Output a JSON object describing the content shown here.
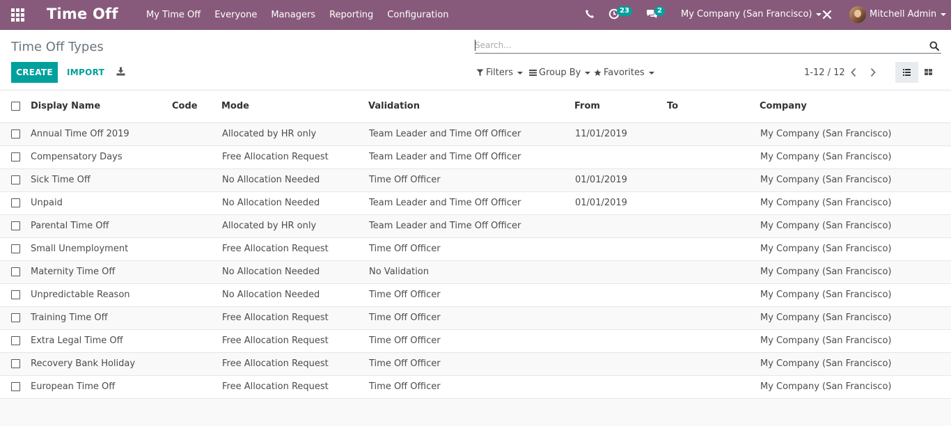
{
  "navbar": {
    "brand": "Time Off",
    "menu": [
      "My Time Off",
      "Everyone",
      "Managers",
      "Reporting",
      "Configuration"
    ],
    "activity_count": "23",
    "message_count": "2",
    "company": "My Company (San Francisco)",
    "user": "Mitchell Admin",
    "accent": "#875a7b"
  },
  "control_panel": {
    "breadcrumb": "Time Off Types",
    "search_placeholder": "Search...",
    "create_label": "CREATE",
    "import_label": "IMPORT",
    "filters_label": "Filters",
    "groupby_label": "Group By",
    "favorites_label": "Favorites",
    "pager": "1-12 / 12",
    "primary_color": "#00a09d"
  },
  "table": {
    "columns": [
      "Display Name",
      "Code",
      "Mode",
      "Validation",
      "From",
      "To",
      "Company"
    ],
    "rows": [
      {
        "name": "Annual Time Off 2019",
        "code": "",
        "mode": "Allocated by HR only",
        "validation": "Team Leader and Time Off Officer",
        "from": "11/01/2019",
        "to": "",
        "company": "My Company (San Francisco)"
      },
      {
        "name": "Compensatory Days",
        "code": "",
        "mode": "Free Allocation Request",
        "validation": "Team Leader and Time Off Officer",
        "from": "",
        "to": "",
        "company": "My Company (San Francisco)"
      },
      {
        "name": "Sick Time Off",
        "code": "",
        "mode": "No Allocation Needed",
        "validation": "Time Off Officer",
        "from": "01/01/2019",
        "to": "",
        "company": "My Company (San Francisco)"
      },
      {
        "name": "Unpaid",
        "code": "",
        "mode": "No Allocation Needed",
        "validation": "Team Leader and Time Off Officer",
        "from": "01/01/2019",
        "to": "",
        "company": "My Company (San Francisco)"
      },
      {
        "name": "Parental Time Off",
        "code": "",
        "mode": "Allocated by HR only",
        "validation": "Team Leader and Time Off Officer",
        "from": "",
        "to": "",
        "company": "My Company (San Francisco)"
      },
      {
        "name": "Small Unemployment",
        "code": "",
        "mode": "Free Allocation Request",
        "validation": "Time Off Officer",
        "from": "",
        "to": "",
        "company": "My Company (San Francisco)"
      },
      {
        "name": "Maternity Time Off",
        "code": "",
        "mode": "No Allocation Needed",
        "validation": "No Validation",
        "from": "",
        "to": "",
        "company": "My Company (San Francisco)"
      },
      {
        "name": "Unpredictable Reason",
        "code": "",
        "mode": "No Allocation Needed",
        "validation": "Time Off Officer",
        "from": "",
        "to": "",
        "company": "My Company (San Francisco)"
      },
      {
        "name": "Training Time Off",
        "code": "",
        "mode": "Free Allocation Request",
        "validation": "Time Off Officer",
        "from": "",
        "to": "",
        "company": "My Company (San Francisco)"
      },
      {
        "name": "Extra Legal Time Off",
        "code": "",
        "mode": "Free Allocation Request",
        "validation": "Time Off Officer",
        "from": "",
        "to": "",
        "company": "My Company (San Francisco)"
      },
      {
        "name": "Recovery Bank Holiday",
        "code": "",
        "mode": "Free Allocation Request",
        "validation": "Time Off Officer",
        "from": "",
        "to": "",
        "company": "My Company (San Francisco)"
      },
      {
        "name": "European Time Off",
        "code": "",
        "mode": "Free Allocation Request",
        "validation": "Time Off Officer",
        "from": "",
        "to": "",
        "company": "My Company (San Francisco)"
      }
    ]
  }
}
